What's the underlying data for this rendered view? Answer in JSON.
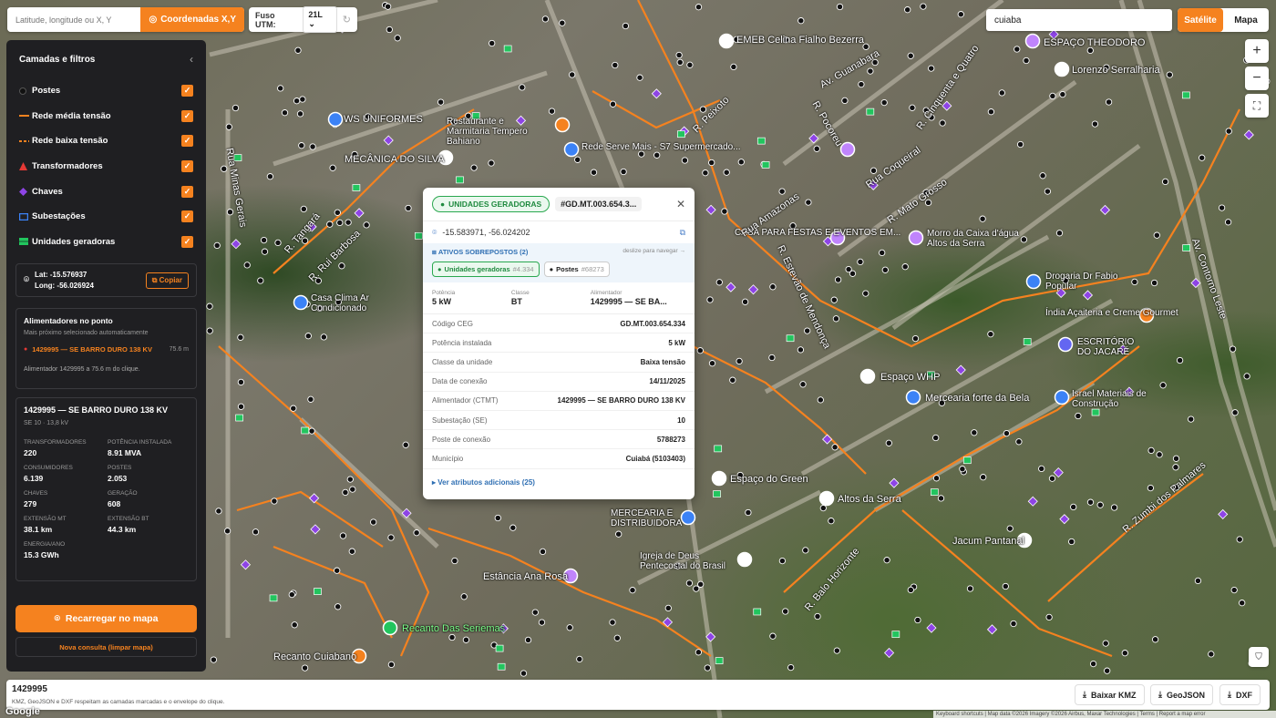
{
  "coord_search": {
    "placeholder": "Latitude, longitude ou X, Y",
    "button_label": "Coordenadas X,Y"
  },
  "fuso": {
    "label": "Fuso UTM:",
    "value": "21L"
  },
  "map_search": {
    "value": "cuiaba"
  },
  "map_type": {
    "satellite": "Satélite",
    "map": "Mapa"
  },
  "zoom": {
    "in": "+",
    "out": "−"
  },
  "panel": {
    "title": "Camadas e filtros",
    "layers": [
      {
        "label": "Postes",
        "icon": "black-dot-icon"
      },
      {
        "label": "Rede média tensão",
        "icon": "orange-line-icon"
      },
      {
        "label": "Rede baixa tensão",
        "icon": "orange-dashed-line-icon"
      },
      {
        "label": "Transformadores",
        "icon": "red-triangle-icon"
      },
      {
        "label": "Chaves",
        "icon": "purple-diamond-icon"
      },
      {
        "label": "Subestações",
        "icon": "blue-square-icon"
      },
      {
        "label": "Unidades geradoras",
        "icon": "green-rect-icon"
      }
    ],
    "location": {
      "lat": "Lat: -15.576937",
      "long": "Long: -56.026924",
      "copy": "Copiar"
    },
    "alimentadores": {
      "title": "Alimentadores no ponto",
      "subtitle": "Mais próximo selecionado automaticamente",
      "item": "1429995 — SE BARRO DURO 138 KV",
      "distance": "75.6 m",
      "footer": "Alimentador 1429995 a 75.6 m do clique."
    },
    "stats": {
      "title": "1429995 — SE BARRO DURO 138 KV",
      "subtitle": "SE 10 · 13,8 kV",
      "items": [
        {
          "k": "TRANSFORMADORES",
          "v": "220"
        },
        {
          "k": "POTÊNCIA INSTALADA",
          "v": "8.91 MVA"
        },
        {
          "k": "CONSUMIDORES",
          "v": "6.139"
        },
        {
          "k": "POSTES",
          "v": "2.053"
        },
        {
          "k": "CHAVES",
          "v": "279"
        },
        {
          "k": "GERAÇÃO",
          "v": "608"
        },
        {
          "k": "EXTENSÃO MT",
          "v": "38.1 km"
        },
        {
          "k": "EXTENSÃO BT",
          "v": "44.3 km"
        },
        {
          "k": "ENERGIA/ANO",
          "v": "15.3 GWh"
        }
      ]
    },
    "reload": "Recarregar no mapa",
    "new_query": "Nova consulta (limpar mapa)"
  },
  "popup": {
    "badge": "UNIDADES GERADORAS",
    "id": "#GD.MT.003.654.3...",
    "coords": "-15.583971, -56.024202",
    "overlap_title": "ATIVOS SOBREPOSTOS (2)",
    "overlap_nav": "deslize para navegar →",
    "chip1": {
      "label": "Unidades geradoras",
      "num": "#4.334"
    },
    "chip2": {
      "label": "Postes",
      "num": "#68273"
    },
    "summary": [
      {
        "k": "Potência",
        "v": "5 kW"
      },
      {
        "k": "Classe",
        "v": "BT"
      },
      {
        "k": "Alimentador",
        "v": "1429995 — SE BA..."
      }
    ],
    "attrs": [
      {
        "k": "Código CEG",
        "v": "GD.MT.003.654.334"
      },
      {
        "k": "Potência instalada",
        "v": "5 kW"
      },
      {
        "k": "Classe da unidade",
        "v": "Baixa tensão"
      },
      {
        "k": "Data de conexão",
        "v": "14/11/2025"
      },
      {
        "k": "Alimentador (CTMT)",
        "v": "1429995 — SE BARRO DURO 138 KV"
      },
      {
        "k": "Subestação (SE)",
        "v": "10"
      },
      {
        "k": "Poste de conexão",
        "v": "5788273"
      },
      {
        "k": "Município",
        "v": "Cuiabá (5103403)"
      }
    ],
    "more": "Ver atributos adicionais (25)"
  },
  "bottom": {
    "code": "1429995",
    "note": "KMZ, GeoJSON e DXF respeitam as camadas marcadas e o envelope do clique.",
    "kmz": "Baixar KMZ",
    "geojson": "GeoJSON",
    "dxf": "DXF"
  },
  "attribution": "Keyboard shortcuts  |  Map data ©2026 Imagery ©2026 Airbus, Maxar Technologies  |  Terms  |  Report a map error",
  "google": "Google",
  "map_labels": [
    "EMEB Celina Fialho Bezerra",
    "ESPAÇO THEODORO",
    "Lorenzo Serralharia",
    "WS UNIFORMES",
    "Restaurante e Marmitaria Tempero Bahiano",
    "Rede Serve Mais - S7 Supermercado...",
    "MECÂNICA DO SILVA",
    "CASA PARA FESTAS E EVENTOS EM...",
    "Morro da Caixa d'água Altos da Serra",
    "Drogaria Dr Fabio Popular",
    "Índia Açaiteria e Creme Gourmet",
    "ESCRITÓRIO DO JACARÉ",
    "Espaço WHP",
    "Mercearia forte da Bela",
    "Israel Materiais de Construção",
    "Casa Clima Ar Condicionado",
    "Espaço do Green",
    "Altos da Serra",
    "MERCEARIA E DISTRIBUIDORA",
    "Igreja de Deus Pentecostal do Brasil",
    "Estância Ana Rosa",
    "Recanto Das Seriemas",
    "Recanto Cuiabano",
    "Jacum Pantanal",
    "Av. Guanabara",
    "R. Peixoto",
    "Rua Amazonas",
    "R. Pocoreu",
    "Rua Coqueiral",
    "R. Mato Grosso",
    "Av. Contorno Leste",
    "R. Estevão de Mendonça",
    "R. Zumbi dos Palmares",
    "R. Balo Horizonte",
    "Rua Minas Gerais",
    "R. Rui Barbosa",
    "R. Tangará",
    "R. Cinquenta e Quatro"
  ]
}
